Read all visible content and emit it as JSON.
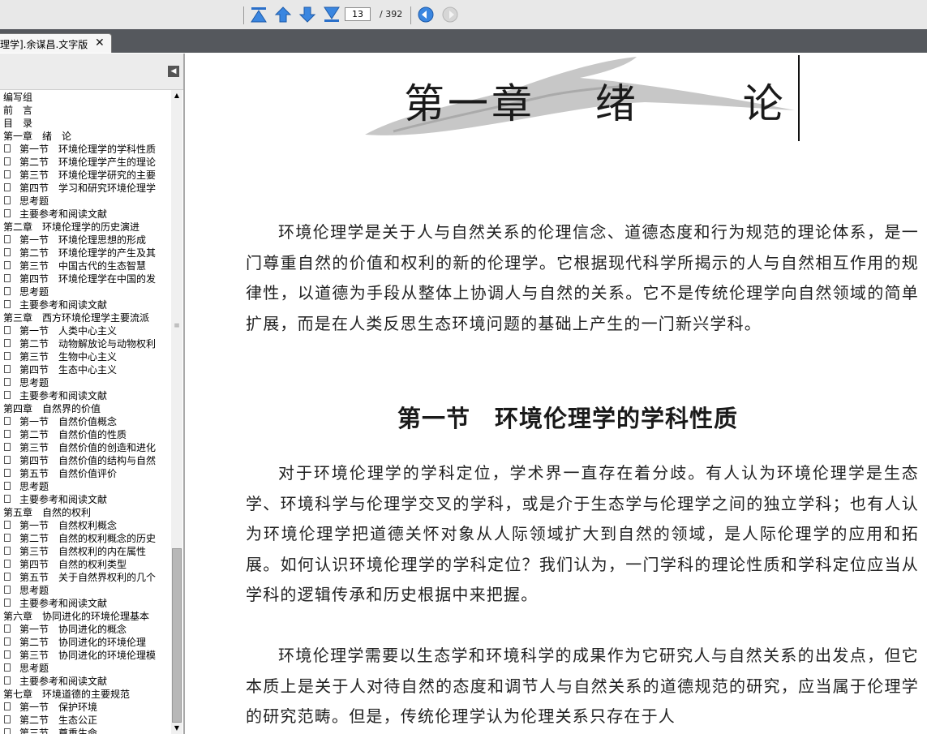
{
  "toolbar": {
    "current_page": "13",
    "total_pages": "/ 392"
  },
  "tab": {
    "title": "理学].余谋昌.文字版",
    "close": "✕"
  },
  "sidebar": {
    "items": [
      {
        "label": "编写组",
        "level": 0
      },
      {
        "label": "前　言",
        "level": 0
      },
      {
        "label": "目　录",
        "level": 0
      },
      {
        "label": "第一章　绪　论",
        "level": 0
      },
      {
        "label": "第一节　环境伦理学的学科性质",
        "level": 1
      },
      {
        "label": "第二节　环境伦理学产生的理论",
        "level": 1
      },
      {
        "label": "第三节　环境伦理学研究的主要",
        "level": 1
      },
      {
        "label": "第四节　学习和研究环境伦理学",
        "level": 1
      },
      {
        "label": "思考题",
        "level": 1
      },
      {
        "label": "主要参考和阅读文献",
        "level": 1
      },
      {
        "label": "第二章　环境伦理学的历史演进",
        "level": 0
      },
      {
        "label": "第一节　环境伦理思想的形成",
        "level": 1
      },
      {
        "label": "第二节　环境伦理学的产生及其",
        "level": 1
      },
      {
        "label": "第三节　中国古代的生态智慧",
        "level": 1
      },
      {
        "label": "第四节　环境伦理学在中国的发",
        "level": 1
      },
      {
        "label": "思考题",
        "level": 1
      },
      {
        "label": "主要参考和阅读文献",
        "level": 1
      },
      {
        "label": "第三章　西方环境伦理学主要流派",
        "level": 0
      },
      {
        "label": "第一节　人类中心主义",
        "level": 1
      },
      {
        "label": "第二节　动物解放论与动物权利",
        "level": 1
      },
      {
        "label": "第三节　生物中心主义",
        "level": 1
      },
      {
        "label": "第四节　生态中心主义",
        "level": 1
      },
      {
        "label": "思考题",
        "level": 1
      },
      {
        "label": "主要参考和阅读文献",
        "level": 1
      },
      {
        "label": "第四章　自然界的价值",
        "level": 0
      },
      {
        "label": "第一节　自然价值概念",
        "level": 1
      },
      {
        "label": "第二节　自然价值的性质",
        "level": 1
      },
      {
        "label": "第三节　自然价值的创造和进化",
        "level": 1
      },
      {
        "label": "第四节　自然价值的结构与自然",
        "level": 1
      },
      {
        "label": "第五节　自然价值评价",
        "level": 1
      },
      {
        "label": "思考题",
        "level": 1
      },
      {
        "label": "主要参考和阅读文献",
        "level": 1
      },
      {
        "label": "第五章　自然的权利",
        "level": 0
      },
      {
        "label": "第一节　自然权利概念",
        "level": 1
      },
      {
        "label": "第二节　自然的权利概念的历史",
        "level": 1
      },
      {
        "label": "第三节　自然权利的内在属性",
        "level": 1
      },
      {
        "label": "第四节　自然的权利类型",
        "level": 1
      },
      {
        "label": "第五节　关于自然界权利的几个",
        "level": 1
      },
      {
        "label": "思考题",
        "level": 1
      },
      {
        "label": "主要参考和阅读文献",
        "level": 1
      },
      {
        "label": "第六章　协同进化的环境伦理基本",
        "level": 0
      },
      {
        "label": "第一节　协同进化的概念",
        "level": 1
      },
      {
        "label": "第二节　协同进化的环境伦理",
        "level": 1
      },
      {
        "label": "第三节　协同进化的环境伦理模",
        "level": 1
      },
      {
        "label": "思考题",
        "level": 1
      },
      {
        "label": "主要参考和阅读文献",
        "level": 1
      },
      {
        "label": "第七章　环境道德的主要规范",
        "level": 0
      },
      {
        "label": "第一节　保护环境",
        "level": 1
      },
      {
        "label": "第二节　生态公正",
        "level": 1
      },
      {
        "label": "第三节　尊重生命",
        "level": 1
      }
    ]
  },
  "document": {
    "chapter_title": "第一章　 绪　 　论",
    "intro": "环境伦理学是关于人与自然关系的伦理信念、道德态度和行为规范的理论体系，是一门尊重自然的价值和权利的新的伦理学。它根据现代科学所揭示的人与自然相互作用的规律性，以道德为手段从整体上协调人与自然的关系。它不是传统伦理学向自然领域的简单扩展，而是在人类反思生态环境问题的基础上产生的一门新兴学科。",
    "section_title": "第一节　环境伦理学的学科性质",
    "para1": "对于环境伦理学的学科定位，学术界一直存在着分歧。有人认为环境伦理学是生态学、环境科学与伦理学交叉的学科，或是介于生态学与伦理学之间的独立学科；也有人认为环境伦理学把道德关怀对象从人际领域扩大到自然的领域，是人际伦理学的应用和拓展。如何认识环境伦理学的学科定位？我们认为，一门学科的理论性质和学科定位应当从学科的逻辑传承和历史根据中来把握。",
    "para2": "环境伦理学需要以生态学和环境科学的成果作为它研究人与自然关系的出发点，但它本质上是关于人对待自然的态度和调节人与自然关系的道德规范的研究，应当属于伦理学的研究范畴。但是，传统伦理学认为伦理关系只存在于人"
  }
}
